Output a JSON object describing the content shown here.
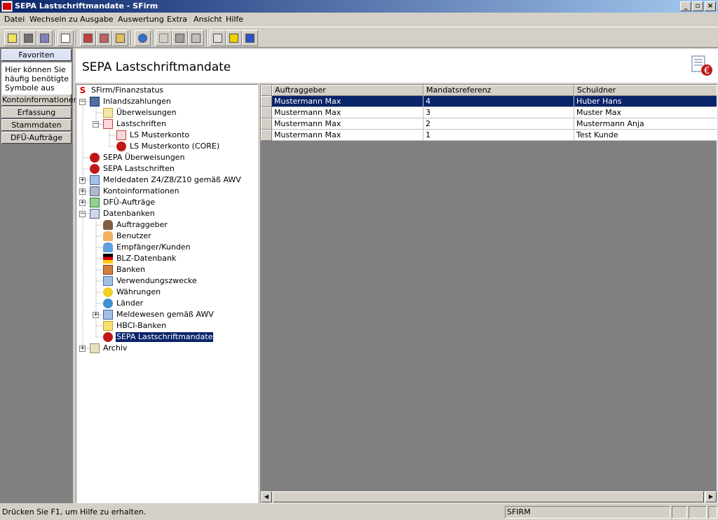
{
  "window": {
    "title": "SEPA Lastschriftmandate - SFirm"
  },
  "menu": [
    "Datei",
    "Wechseln zu",
    "Ausgabe",
    "Auswertung",
    "Extra",
    "Ansicht",
    "Hilfe"
  ],
  "toolbar": {
    "icons": [
      "form-icon",
      "back-icon",
      "save-icon",
      "new-document-icon",
      "add-icon",
      "delete-icon",
      "properties-icon",
      "internet-explorer-icon",
      "cut-icon",
      "copy-icon",
      "paste-icon",
      "print-icon",
      "help-icon",
      "context-help-icon"
    ]
  },
  "nav": {
    "favoriten": "Favoriten",
    "fav_text": "Hier können Sie häufig benötigte Symbole aus dem",
    "kontoinformationen": "Kontoinformationen",
    "erfassung": "Erfassung",
    "stammdaten": "Stammdaten",
    "dfu": "DFÜ-Aufträge"
  },
  "page": {
    "title": "SEPA Lastschriftmandate"
  },
  "tree": [
    {
      "label": "SFirm/Finanzstatus"
    },
    {
      "label": "Inlandszahlungen"
    },
    {
      "label": "Überweisungen"
    },
    {
      "label": "Lastschriften"
    },
    {
      "label": "LS Musterkonto"
    },
    {
      "label": "LS Musterkonto (CORE)"
    },
    {
      "label": "SEPA Überweisungen"
    },
    {
      "label": "SEPA Lastschriften"
    },
    {
      "label": "Meldedaten Z4/Z8/Z10 gemäß AWV"
    },
    {
      "label": "Kontoinformationen"
    },
    {
      "label": "DFÜ-Aufträge"
    },
    {
      "label": "Datenbanken"
    },
    {
      "label": "Auftraggeber"
    },
    {
      "label": "Benutzer"
    },
    {
      "label": "Empfänger/Kunden"
    },
    {
      "label": "BLZ-Datenbank"
    },
    {
      "label": "Banken"
    },
    {
      "label": "Verwendungszwecke"
    },
    {
      "label": "Währungen"
    },
    {
      "label": "Länder"
    },
    {
      "label": "Meldewesen gemäß AWV"
    },
    {
      "label": "HBCI-Banken"
    },
    {
      "label": "SEPA Lastschriftmandate"
    },
    {
      "label": "Archiv"
    }
  ],
  "grid": {
    "columns": [
      "Auftraggeber",
      "Mandatsreferenz",
      "Schuldner"
    ],
    "rows": [
      [
        "Mustermann Max",
        "4",
        "Huber Hans"
      ],
      [
        "Mustermann Max",
        "3",
        "Muster Max"
      ],
      [
        "Mustermann Max",
        "2",
        "Mustermann Anja"
      ],
      [
        "Mustermann Max",
        "1",
        "Test Kunde"
      ]
    ]
  },
  "status": {
    "help": "Drücken Sie F1, um Hilfe zu erhalten.",
    "app": "SFIRM"
  },
  "colors": {
    "selection": "#0a246a",
    "titlebar": "#0a246a",
    "face": "#d4d0c8"
  }
}
